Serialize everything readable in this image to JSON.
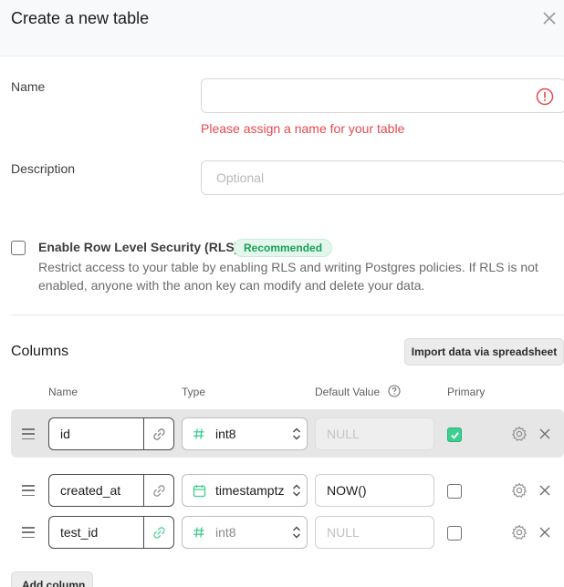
{
  "dialog": {
    "title": "Create a new table",
    "close_icon": "close-icon"
  },
  "form": {
    "name_label": "Name",
    "name_value": "",
    "name_error": "Please assign a name for your table",
    "description_label": "Description",
    "description_placeholder": "Optional"
  },
  "rls": {
    "title": "Enable Row Level Security (RLS)",
    "badge": "Recommended",
    "description": "Restrict access to your table by enabling RLS and writing Postgres policies. If RLS is not enabled, anyone with the anon key can modify and delete your data.",
    "checked": false
  },
  "columns": {
    "title": "Columns",
    "import_label": "Import data via spreadsheet",
    "headers": {
      "name": "Name",
      "type": "Type",
      "default": "Default Value",
      "primary": "Primary"
    },
    "rows": [
      {
        "name": "id",
        "type": "int8",
        "type_icon": "hash-icon",
        "default": "NULL",
        "default_is_placeholder": true,
        "primary": true
      },
      {
        "name": "created_at",
        "type": "timestamptz",
        "type_icon": "calendar-icon",
        "default": "NOW()",
        "default_is_placeholder": false,
        "primary": false
      },
      {
        "name": "test_id",
        "type": "int8",
        "type_icon": "hash-icon",
        "default": "NULL",
        "default_is_placeholder": true,
        "primary": false
      }
    ],
    "add_label": "Add column"
  },
  "colors": {
    "accent": "#3ecf8e",
    "error": "#e5484d",
    "badge_text": "#18a058"
  }
}
